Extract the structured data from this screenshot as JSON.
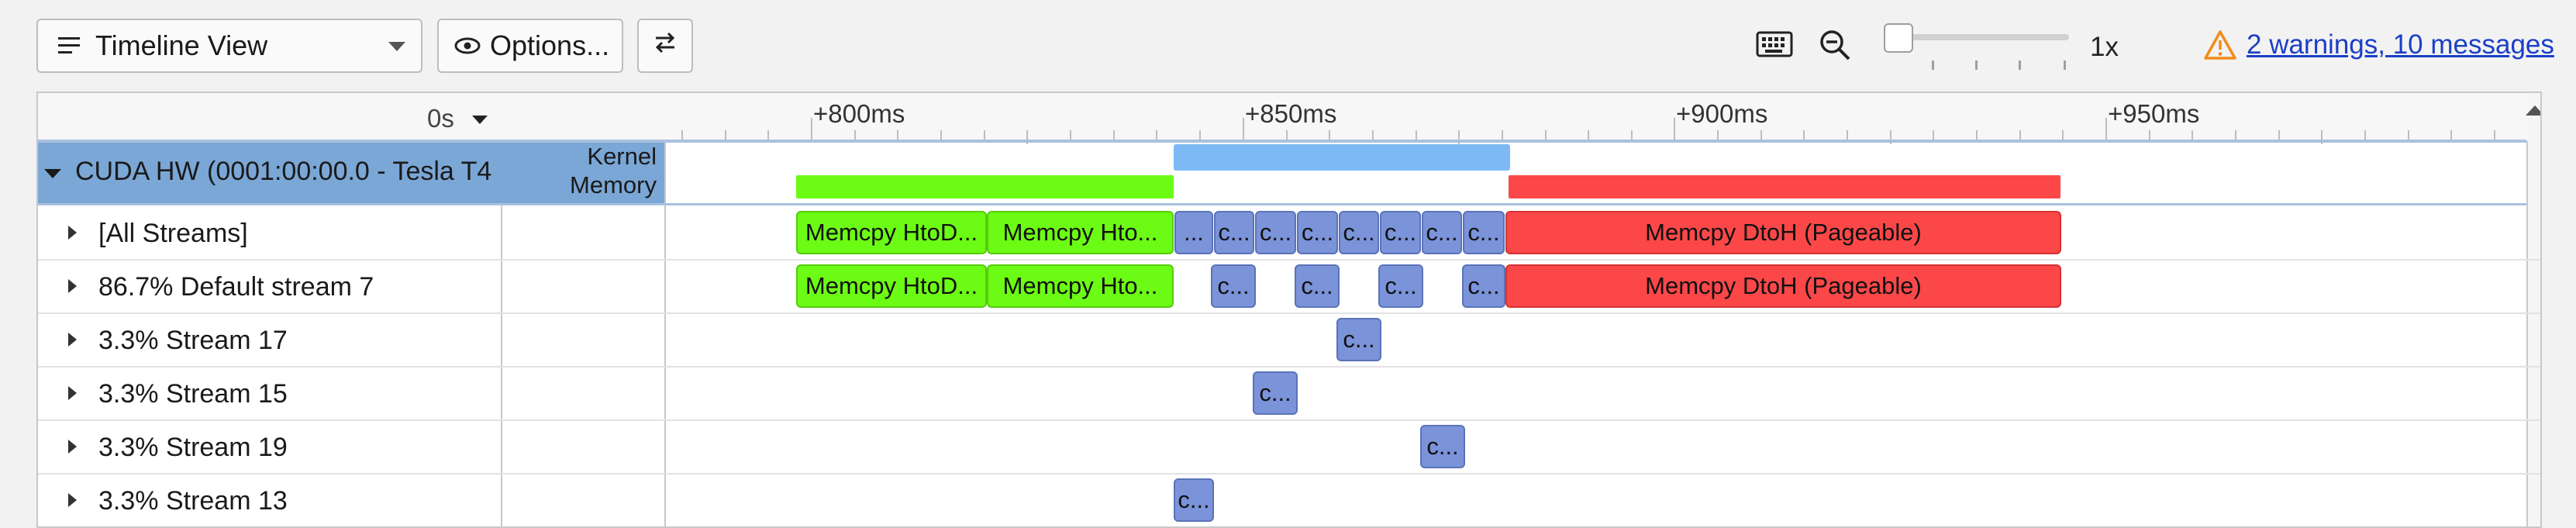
{
  "toolbar": {
    "view_select": "Timeline View",
    "options_label": "Options...",
    "zoom_label": "1x",
    "warnings_link": "2 warnings, 10 messages",
    "warning_color": "#f08c1a"
  },
  "timeline": {
    "header_time": "0s",
    "ruler_labels": [
      "+800ms",
      "+850ms",
      "+900ms",
      "+950ms"
    ],
    "device_row": {
      "label": "CUDA HW (0001:00:00.0 - Tesla T4",
      "kernel_label": "Kernel",
      "memory_label": "Memory"
    },
    "rows": [
      {
        "label": "[All Streams]"
      },
      {
        "label": "86.7% Default stream 7"
      },
      {
        "label": "3.3% Stream 17"
      },
      {
        "label": "3.3% Stream 15"
      },
      {
        "label": "3.3% Stream 19"
      },
      {
        "label": "3.3% Stream 13"
      }
    ],
    "bars": {
      "htod_1": "Memcpy HtoD...",
      "htod_2": "Memcpy Hto...",
      "dtoh": "Memcpy DtoH (Pageable)",
      "ellipsis": "...",
      "kernel_short": "c..."
    },
    "colors": {
      "htod": "#6cfb14",
      "dtoh": "#fb4748",
      "kernel": "#7a93d9",
      "kernel_summary": "#7dbaf5",
      "device_row_bg": "#7ba7d6"
    }
  }
}
